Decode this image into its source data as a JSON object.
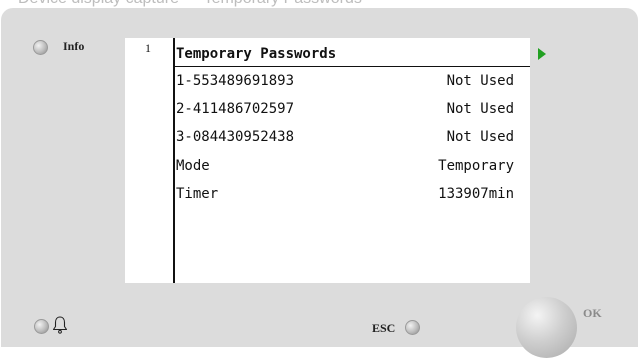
{
  "header_partial_text": "Device display capture — Temporary Passwords",
  "device": {
    "info_label": "Info",
    "esc_label": "ESC",
    "ok_label": "OK"
  },
  "screen": {
    "page_number": "1",
    "title": "Temporary Passwords",
    "rows": [
      {
        "label": "1-553489691893",
        "value": "Not Used"
      },
      {
        "label": "2-411486702597",
        "value": "Not Used"
      },
      {
        "label": "3-084430952438",
        "value": "Not Used"
      },
      {
        "label": "Mode",
        "value": "Temporary"
      },
      {
        "label": "Timer",
        "value": "133907min"
      }
    ],
    "arrow_color": "#22a022"
  },
  "icons": {
    "bell": "bell-icon",
    "next": "right-arrow-icon"
  }
}
